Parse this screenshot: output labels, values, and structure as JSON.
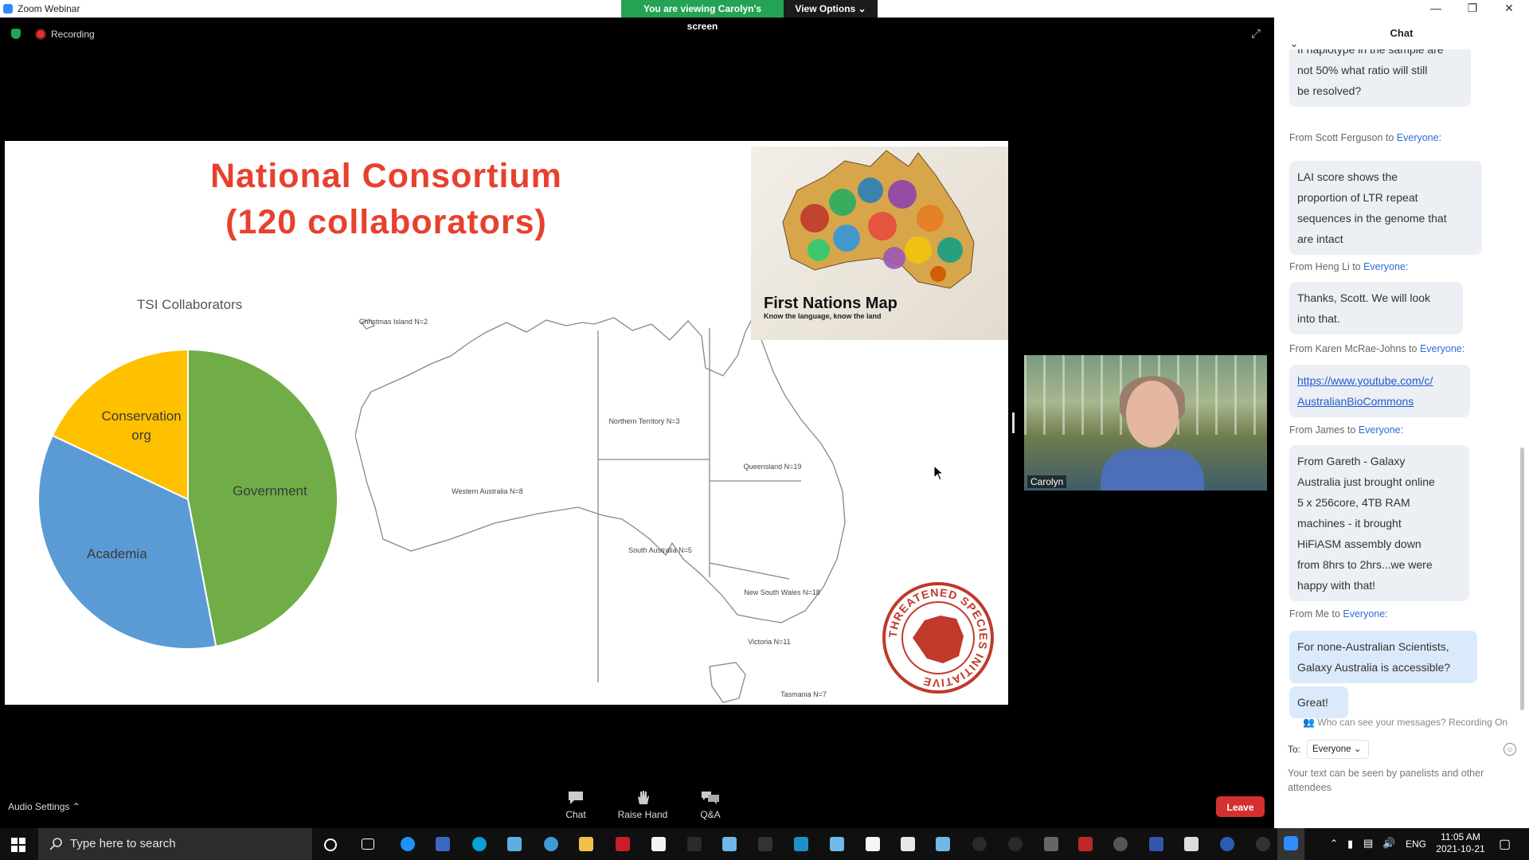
{
  "window": {
    "app_title": "Zoom Webinar",
    "banner_viewing": "You are viewing Carolyn's screen",
    "view_options": "View Options ⌄",
    "minimize": "—",
    "restore": "❐",
    "close": "✕"
  },
  "meeting": {
    "recording_label": "Recording",
    "fullscreen_glyph": "⤢"
  },
  "slide": {
    "title_line1": "National Consortium",
    "title_line2": "(120 collaborators)",
    "pie_title": "TSI Collaborators",
    "map_labels": {
      "christmas_island": "Christmas Island N=2",
      "western_australia": "Western Australia N=8",
      "northern_territory": "Northern Territory N=3",
      "queensland": "Queensland N=19",
      "south_australia": "South Australia N=5",
      "new_south_wales": "New South Wales N=18",
      "victoria": "Victoria N=11",
      "tasmania": "Tasmania N=7"
    },
    "first_nations_title": "First Nations Map",
    "first_nations_subtitle": "Know the language, know the land",
    "stamp_text": "THREATENED SPECIES INITIATIVE"
  },
  "chart_data": {
    "type": "pie",
    "title": "TSI Collaborators",
    "categories": [
      "Government",
      "Academia",
      "Conservation org"
    ],
    "values": [
      47,
      35,
      18
    ],
    "colors": [
      "#70ad47",
      "#5b9bd5",
      "#ffc000"
    ]
  },
  "video": {
    "participant_name": "Carolyn"
  },
  "toolbar": {
    "audio_settings": "Audio Settings",
    "chat": "Chat",
    "raise_hand": "Raise Hand",
    "qa": "Q&A",
    "leave": "Leave"
  },
  "chat": {
    "header": "Chat",
    "messages": [
      {
        "from": "",
        "to": "",
        "text_lines": [
          "If haplotype in the sample are",
          "not 50% what ratio will still",
          "be resolved?"
        ]
      },
      {
        "from": "From Scott Ferguson to ",
        "to": "Everyone:",
        "text_lines": [
          "LAI score shows the",
          "proportion of LTR repeat",
          "sequences in the genome that",
          "are intact"
        ]
      },
      {
        "from": "From Heng Li to ",
        "to": "Everyone:",
        "text_lines": [
          "Thanks, Scott. We will look",
          "into that."
        ]
      },
      {
        "from": "From Karen McRae-Johns to ",
        "to": "Everyone:",
        "text_lines": [
          "https://www.youtube.com/c/",
          "AustralianBioCommons"
        ]
      },
      {
        "from": "From James to ",
        "to": "Everyone:",
        "text_lines": [
          "From Gareth - Galaxy",
          "Australia just brought online",
          "5 x 256core, 4TB RAM",
          "machines - it brought",
          "HiFiASM assembly down",
          "from 8hrs to 2hrs...we were",
          "happy with that!"
        ]
      },
      {
        "from": "From Me to ",
        "to": "Everyone:",
        "text_lines": [
          "For none-Australian Scientists,",
          "Galaxy Australia is accessible?"
        ]
      },
      {
        "from": "",
        "to": "",
        "text_lines": [
          "Great!"
        ]
      }
    ],
    "who_can_see": "Who can see your messages? Recording On",
    "to_label": "To:",
    "to_value": "Everyone ⌄",
    "input_placeholder": "Your text can be seen by panelists and other attendees"
  },
  "taskbar": {
    "search_placeholder": "Type here to search",
    "language": "ENG",
    "time": "11:05 AM",
    "date": "2021-10-21"
  }
}
